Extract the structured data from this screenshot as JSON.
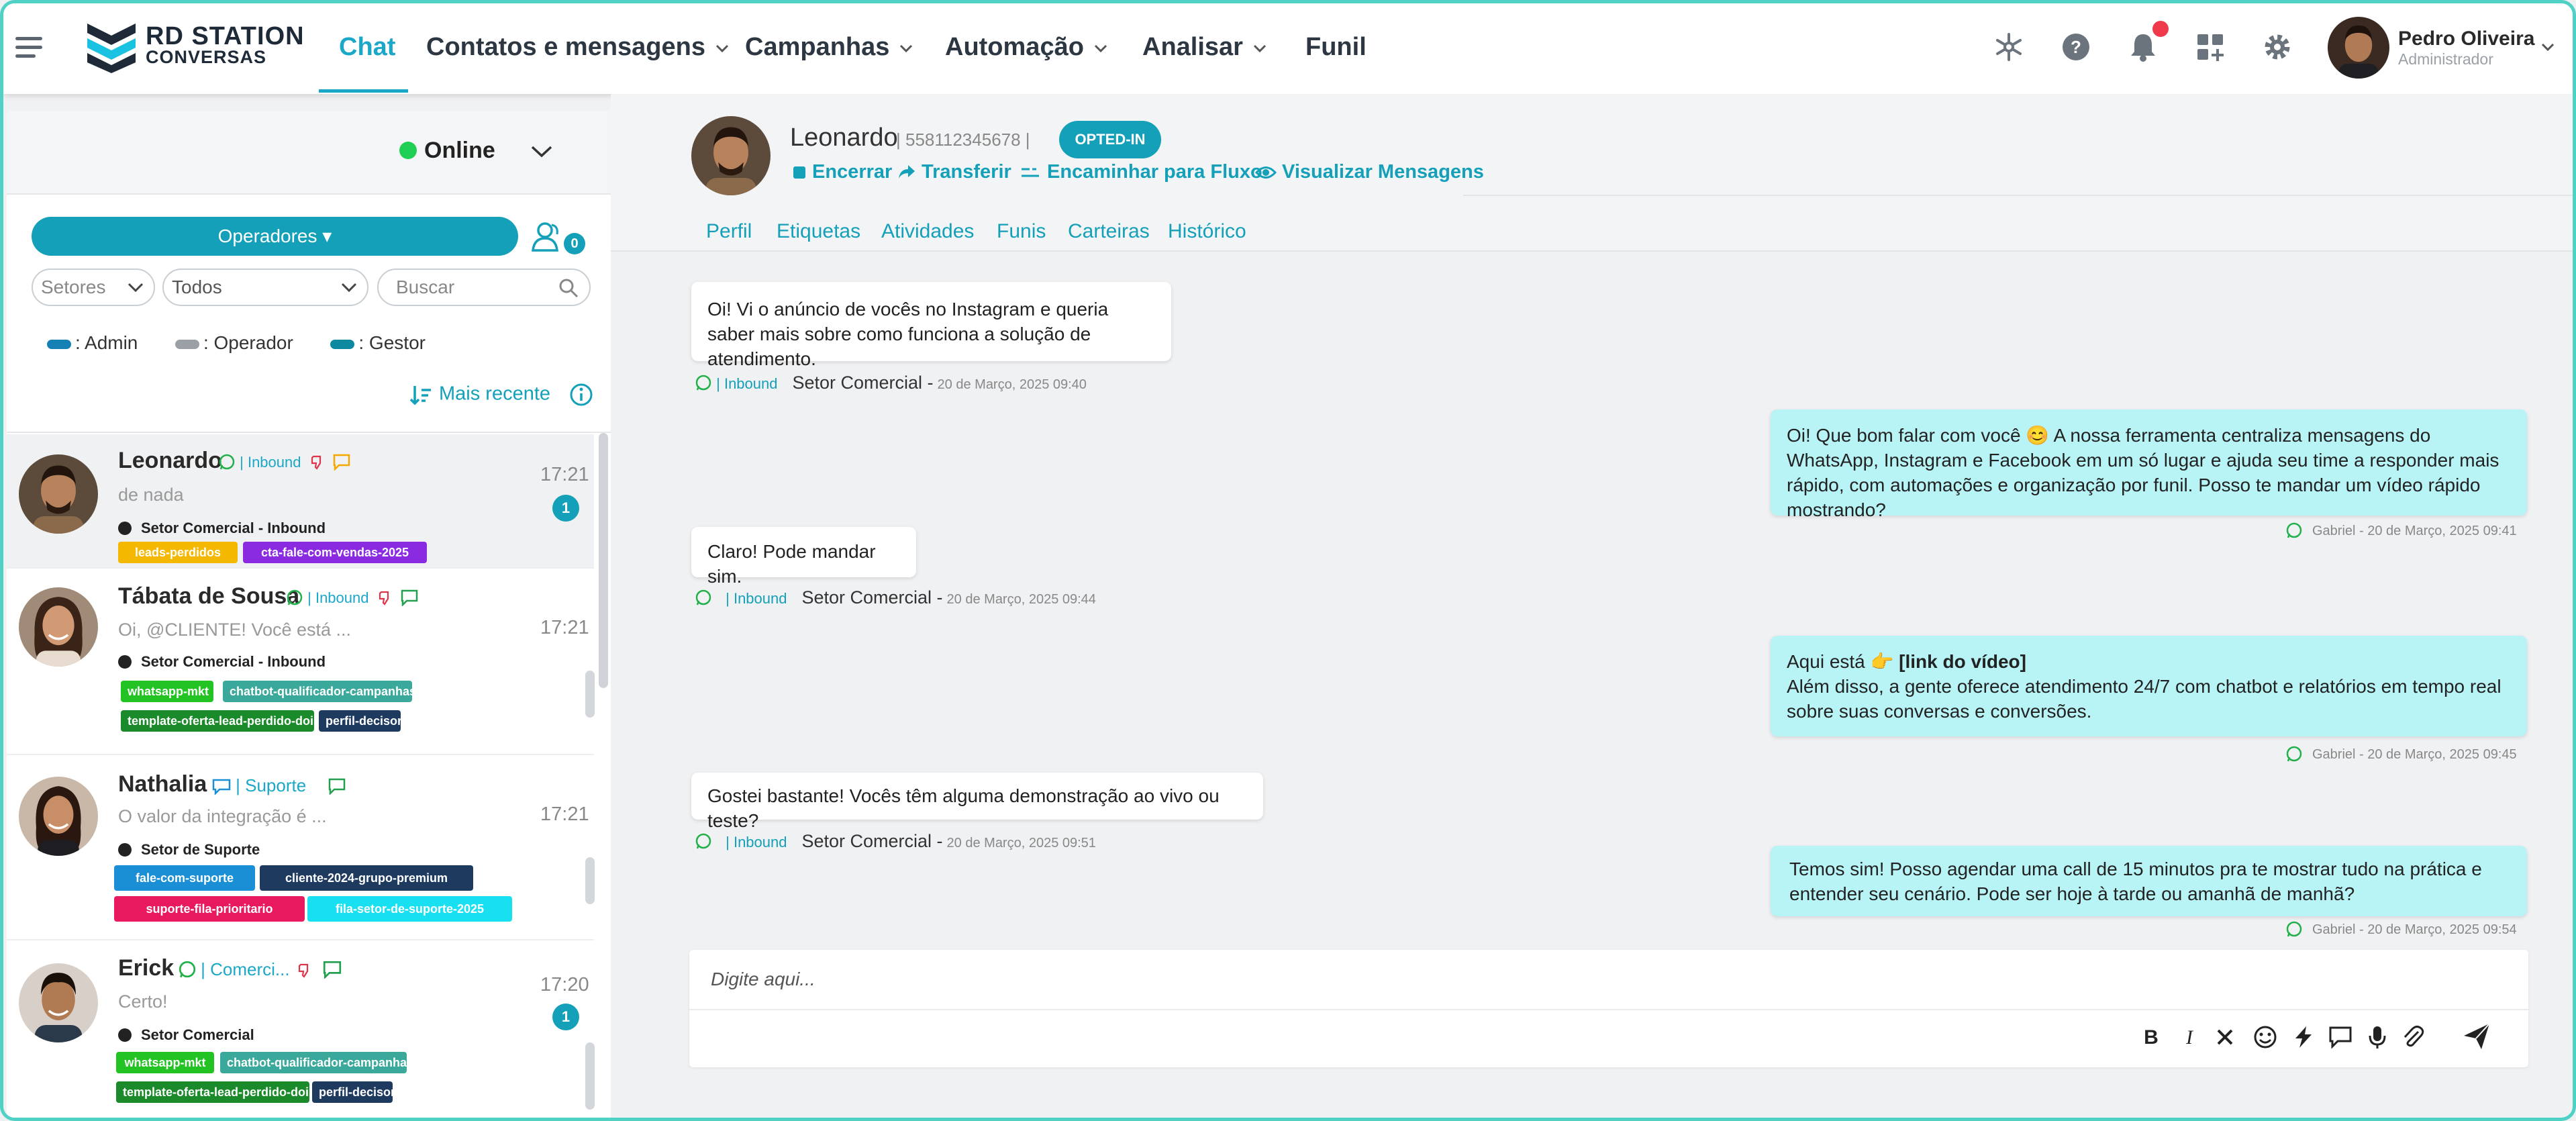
{
  "nav": {
    "logo_line1": "RD STATION",
    "logo_line2": "CONVERSAS",
    "items": [
      {
        "label": "Chat"
      },
      {
        "label": "Contatos e mensagens"
      },
      {
        "label": "Campanhas"
      },
      {
        "label": "Automação"
      },
      {
        "label": "Analisar"
      },
      {
        "label": "Funil"
      }
    ],
    "active": "Chat",
    "user": {
      "name": "Pedro Oliveira",
      "role": "Administrador"
    },
    "colors": {
      "accent": "#1ba8c8",
      "notification": "#f0394a"
    }
  },
  "sidebar": {
    "status": "Online",
    "operators_label": "Operadores",
    "operators_count": "0",
    "filters": {
      "setores_placeholder": "Setores",
      "todos_value": "Todos",
      "search_placeholder": "Buscar"
    },
    "roles": [
      {
        "label": ": Admin",
        "color": "#1581b5"
      },
      {
        "label": ": Operador",
        "color": "#9aa0a6"
      },
      {
        "label": ": Gestor",
        "color": "#0d8aa0"
      }
    ],
    "sort_label": "Mais recente",
    "contacts": [
      {
        "name": "Leonardo",
        "channel": "| Inbound",
        "preview": "de nada",
        "time": "17:21",
        "unread": "1",
        "sector": "Setor Comercial - Inbound",
        "tags": [
          {
            "label": "leads-perdidos",
            "color": "#f5b800"
          },
          {
            "label": "cta-fale-com-vendas-2025",
            "color": "#8a2be2"
          }
        ]
      },
      {
        "name": "Tábata de Sousa",
        "channel": "| Inbound",
        "preview": "Oi, @CLIENTE! Você está ...",
        "time": "17:21",
        "sector": "Setor Comercial - Inbound",
        "tags": [
          {
            "label": "whatsapp-mkt",
            "color": "#22c322"
          },
          {
            "label": "chatbot-qualificador-campanhas",
            "color": "#3aa89a"
          },
          {
            "label": "template-oferta-lead-perdido-dois",
            "color": "#1b8a2a"
          },
          {
            "label": "perfil-decisor",
            "color": "#1e3a5f"
          }
        ]
      },
      {
        "name": "Nathalia",
        "channel": "| Suporte",
        "preview": "O valor da integração é ...",
        "time": "17:21",
        "sector": "Setor de Suporte",
        "tags": [
          {
            "label": "fale-com-suporte",
            "color": "#1a8fd6"
          },
          {
            "label": "cliente-2024-grupo-premium",
            "color": "#1e3a5f"
          },
          {
            "label": "suporte-fila-prioritario",
            "color": "#e8195e"
          },
          {
            "label": "fila-setor-de-suporte-2025",
            "color": "#19e0f0"
          }
        ]
      },
      {
        "name": "Erick",
        "channel": "| Comerci...",
        "preview": "Certo!",
        "time": "17:20",
        "unread": "1",
        "sector": "Setor Comercial",
        "tags": [
          {
            "label": "whatsapp-mkt",
            "color": "#22c322"
          },
          {
            "label": "chatbot-qualificador-campanhas",
            "color": "#3aa89a"
          },
          {
            "label": "template-oferta-lead-perdido-dois",
            "color": "#1b8a2a"
          },
          {
            "label": "perfil-decisor",
            "color": "#1e3a5f"
          }
        ]
      }
    ]
  },
  "chat": {
    "contact_name": "Leonardo",
    "phone": "| 558112345678 |",
    "optin_badge": "OPTED-IN",
    "actions": [
      "Encerrar",
      "Transferir",
      "Encaminhar para Fluxo",
      "Visualizar Mensagens"
    ],
    "tabs": [
      "Perfil",
      "Etiquetas",
      "Atividades",
      "Funis",
      "Carteiras",
      "Histórico"
    ],
    "messages": [
      {
        "dir": "in",
        "text": "Oi! Vi o anúncio de vocês no Instagram e queria saber mais sobre como funciona a solução de atendimento.",
        "channel": "| Inbound",
        "sector": "Setor Comercial -",
        "date": "20 de Março, 2025 09:40"
      },
      {
        "dir": "out",
        "text": "Oi! Que bom falar com você 😊 A nossa ferramenta centraliza mensagens do WhatsApp, Instagram e Facebook em um só lugar e ajuda seu time a responder mais rápido, com automações e organização por funil. Posso te mandar um vídeo rápido mostrando?",
        "meta": "Gabriel - 20 de Março, 2025 09:41"
      },
      {
        "dir": "in",
        "text": "Claro! Pode mandar sim.",
        "channel": "| Inbound",
        "sector": "Setor Comercial -",
        "date": "20 de Março, 2025 09:44"
      },
      {
        "dir": "out",
        "text_prefix": "Aqui está 👉 ",
        "text_bold": "[link do vídeo]",
        "text": "Além disso, a gente oferece atendimento 24/7 com chatbot e relatórios em tempo real sobre suas conversas e conversões.",
        "meta": "Gabriel - 20 de Março, 2025 09:45"
      },
      {
        "dir": "in",
        "text": "Gostei bastante! Vocês têm alguma demonstração ao vivo ou teste?",
        "channel": "| Inbound",
        "sector": "Setor Comercial -",
        "date": "20 de Março, 2025 09:51"
      },
      {
        "dir": "out",
        "text": "Temos sim! Posso agendar uma call de 15 minutos pra te mostrar tudo na prática e entender seu cenário. Pode ser hoje à tarde ou amanhã de manhã?",
        "meta": "Gabriel - 20 de Março, 2025 09:54"
      }
    ],
    "composer_placeholder": "Digite aqui..."
  }
}
